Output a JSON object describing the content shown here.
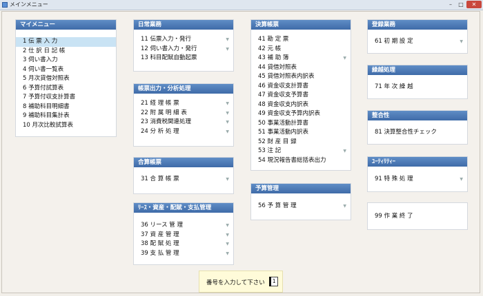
{
  "window": {
    "title": "メインメニュー",
    "minimize": "–",
    "maximize": "□",
    "close": "✕"
  },
  "panels": {
    "main_menu": {
      "title": "マイメニュー",
      "items": [
        "1 伝 票 入 力",
        "2 仕 訳 日 記 帳",
        "3 伺い書入力",
        "4 伺い書一覧表",
        "5 月次貸借対照表",
        "6 予算付試算表",
        "7 予算付収支計算書",
        "8 補助科目明細書",
        "9 補助科目集計表",
        "10 月次比較試算表"
      ],
      "selected_index": 0
    },
    "daily": {
      "title": "日常業務",
      "items": [
        "11 伝票入力・発行",
        "12 伺い書入力・発行",
        "13 科目配賦自動起票"
      ]
    },
    "reports": {
      "title": "帳票出力・分析処理",
      "items": [
        "21 経 理 帳 票",
        "22 附 属 明 細 表",
        "23 消費税関連処理",
        "24 分 析 処 理"
      ]
    },
    "consolidated": {
      "title": "合算帳票",
      "items": [
        "31 合 算 帳 票"
      ]
    },
    "lease": {
      "title": "ﾘｰｽ・資産・配賦・支払管理",
      "items": [
        "36 リース 管 理",
        "37 資 産 管 理",
        "38 配 賦 処 理",
        "39 支 払 管 理"
      ]
    },
    "closing": {
      "title": "決算帳票",
      "items": [
        "41 勘 定 票",
        "42 元 帳",
        "43 補 助 簿",
        "44 貸借対照表",
        "45 貸借対照表内訳表",
        "46 資金収支計算書",
        "47 資金収支予算書",
        "48 資金収支内訳表",
        "49 資金収支予算内訳表",
        "50 事業活動計算書",
        "51 事業活動内訳表",
        "52 財 産 目 録",
        "53 注 記",
        "54 現況報告書総括表出力"
      ]
    },
    "budget": {
      "title": "予算管理",
      "items": [
        "56 予 算 管 理"
      ]
    },
    "registration": {
      "title": "登録業務",
      "items": [
        "61 初 期 設 定"
      ]
    },
    "carryover": {
      "title": "繰越処理",
      "items": [
        "71 年 次 繰 越"
      ]
    },
    "consistency": {
      "title": "整合性",
      "items": [
        "81 決算整合性チェック"
      ]
    },
    "utility": {
      "title": "ﾕｰﾃｨﾘﾃｨｰ",
      "items": [
        "91 特 殊 処 理"
      ]
    },
    "exit": {
      "items": [
        "99 作 業 終 了"
      ]
    }
  },
  "footer": {
    "prompt": "番号を入力して下さい",
    "input_value": "1"
  },
  "arrow_glyph": "▼"
}
